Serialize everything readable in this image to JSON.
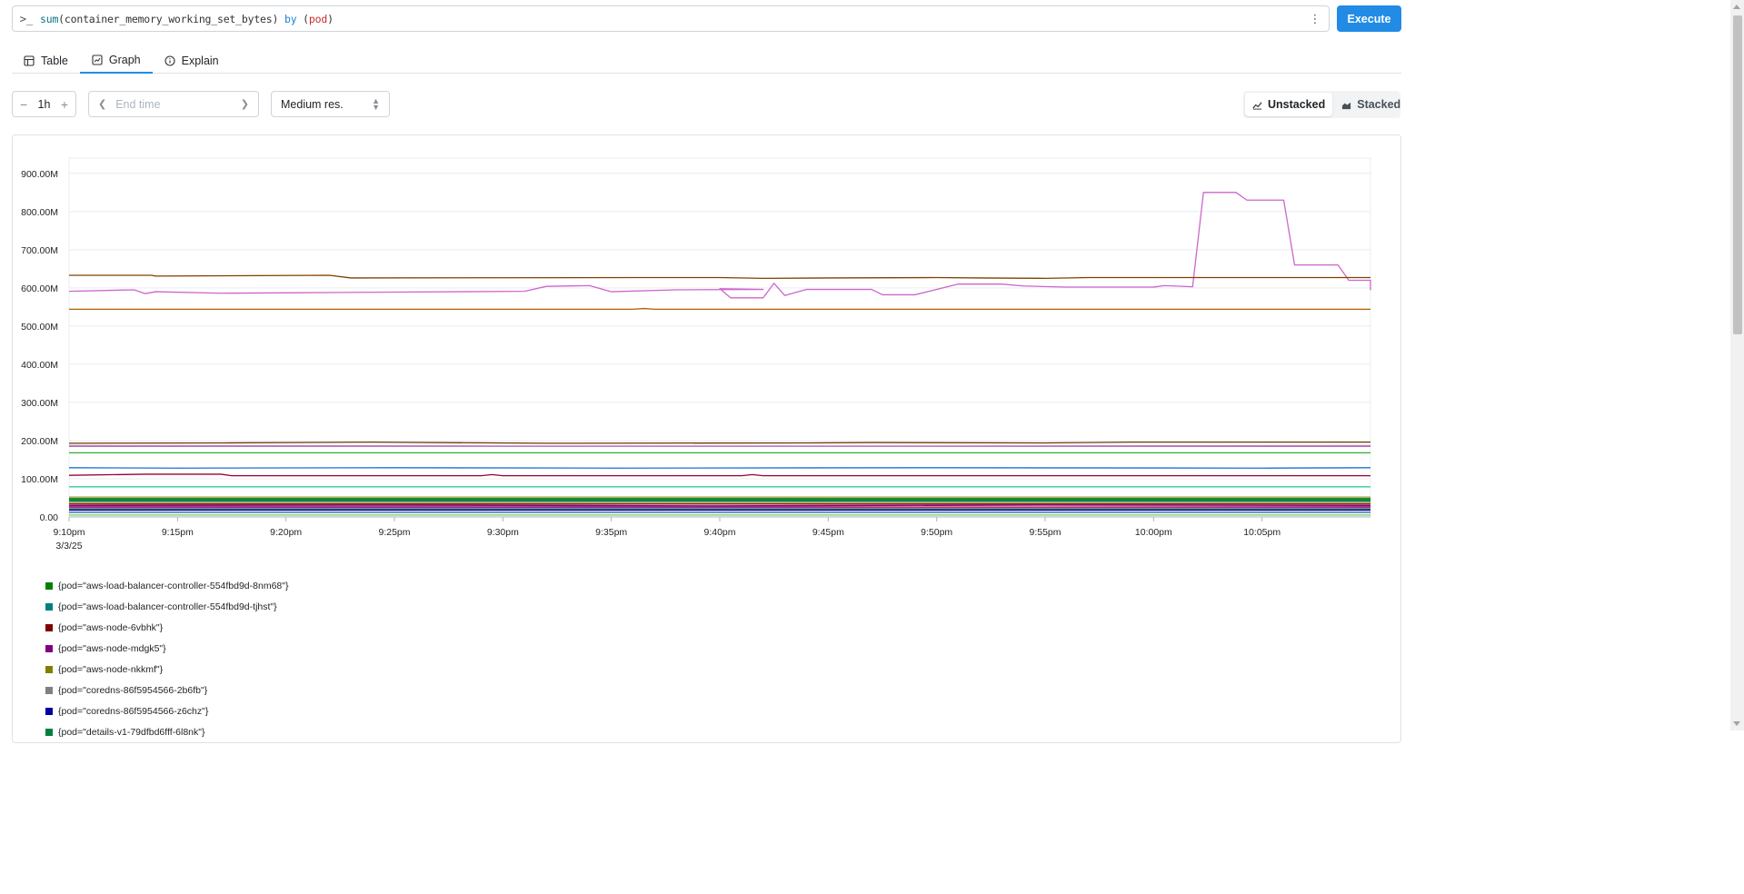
{
  "query": {
    "prompt": ">_",
    "fn": "sum",
    "arg": "(container_memory_working_set_bytes)",
    "by": "by",
    "open_paren": "(",
    "label": "pod",
    "close_paren": ")",
    "menu_icon": "dots-vertical-icon",
    "execute_label": "Execute"
  },
  "tabs": [
    {
      "label": "Table",
      "icon": "table-icon",
      "active": false
    },
    {
      "label": "Graph",
      "icon": "chart-area-icon",
      "active": true
    },
    {
      "label": "Explain",
      "icon": "info-circle-icon",
      "active": false
    }
  ],
  "controls": {
    "range_value": "1h",
    "minus": "−",
    "plus": "+",
    "end_time_placeholder": "End time",
    "resolution": "Medium res.",
    "unstacked_label": "Unstacked",
    "stacked_label": "Stacked",
    "mode": "unstacked"
  },
  "chart_data": {
    "type": "line",
    "y_ticks": [
      "0.00",
      "100.00M",
      "200.00M",
      "300.00M",
      "400.00M",
      "500.00M",
      "600.00M",
      "700.00M",
      "800.00M",
      "900.00M"
    ],
    "ylim": [
      0,
      940
    ],
    "y_unit": "M",
    "x_ticks": [
      "9:10pm",
      "9:15pm",
      "9:20pm",
      "9:25pm",
      "9:30pm",
      "9:35pm",
      "9:40pm",
      "9:45pm",
      "9:50pm",
      "9:55pm",
      "10:00pm",
      "10:05pm"
    ],
    "x_tick_minutes": [
      0,
      5,
      10,
      15,
      20,
      25,
      30,
      35,
      40,
      45,
      50,
      55
    ],
    "x_date_label": "3/3/25",
    "xlim_minutes": [
      0,
      60
    ],
    "grid": true,
    "legend_position": "bottom",
    "series": [
      {
        "name": "{pod=\"aws-load-balancer-controller-554fbd9d-8nm68\"}",
        "color": "#008000",
        "points": [
          [
            0,
            48
          ],
          [
            60,
            48
          ]
        ]
      },
      {
        "name": "{pod=\"aws-load-balancer-controller-554fbd9d-tjhst\"}",
        "color": "#008080",
        "points": [
          [
            0,
            44
          ],
          [
            60,
            44
          ]
        ]
      },
      {
        "name": "{pod=\"aws-node-6vbhk\"}",
        "color": "#800000",
        "points": [
          [
            0,
            34
          ],
          [
            60,
            34
          ]
        ]
      },
      {
        "name": "{pod=\"aws-node-mdgk5\"}",
        "color": "#800080",
        "points": [
          [
            0,
            30
          ],
          [
            15,
            31
          ],
          [
            30,
            29
          ],
          [
            45,
            31
          ],
          [
            60,
            30
          ]
        ]
      },
      {
        "name": "{pod=\"aws-node-nkkmf\"}",
        "color": "#808000",
        "points": [
          [
            0,
            38
          ],
          [
            60,
            38
          ]
        ]
      },
      {
        "name": "{pod=\"coredns-86f5954566-2b6fb\"}",
        "color": "#808080",
        "points": [
          [
            0,
            22
          ],
          [
            60,
            22
          ]
        ]
      },
      {
        "name": "{pod=\"coredns-86f5954566-z6chz\"}",
        "color": "#0000a0",
        "points": [
          [
            0,
            18
          ],
          [
            60,
            18
          ]
        ]
      },
      {
        "name": "{pod=\"details-v1-79dfbd6fff-6l8nk\"}",
        "color": "#008040",
        "points": [
          [
            0,
            42
          ],
          [
            60,
            42
          ]
        ]
      },
      {
        "name": "",
        "color": "#804000",
        "points": [
          [
            0,
            633
          ],
          [
            3.8,
            633
          ],
          [
            4,
            631
          ],
          [
            12,
            633
          ],
          [
            13,
            626
          ],
          [
            26,
            627
          ],
          [
            30,
            627
          ],
          [
            32,
            625
          ],
          [
            35,
            626
          ],
          [
            40,
            627
          ],
          [
            42,
            626
          ],
          [
            45,
            625
          ],
          [
            47,
            627
          ],
          [
            53,
            627
          ],
          [
            60,
            627
          ]
        ]
      },
      {
        "name": "",
        "color": "#cc66cc",
        "points": [
          [
            0,
            591
          ],
          [
            3,
            595
          ],
          [
            3.5,
            585
          ],
          [
            4,
            590
          ],
          [
            7,
            586
          ],
          [
            10,
            587
          ],
          [
            15,
            589
          ],
          [
            21,
            591
          ],
          [
            22,
            604
          ],
          [
            24,
            606
          ],
          [
            25,
            590
          ],
          [
            28,
            595
          ],
          [
            32,
            596
          ],
          [
            30,
            598
          ],
          [
            30.5,
            574
          ],
          [
            32,
            574
          ],
          [
            32.5,
            612
          ],
          [
            33,
            580
          ],
          [
            34,
            596
          ],
          [
            37,
            596
          ],
          [
            37.5,
            582
          ],
          [
            39,
            582
          ],
          [
            41,
            610
          ],
          [
            43,
            610
          ],
          [
            44,
            605
          ],
          [
            46,
            602
          ],
          [
            50,
            602
          ],
          [
            50.5,
            606
          ],
          [
            51.8,
            603
          ],
          [
            52.3,
            850
          ],
          [
            53.8,
            850
          ],
          [
            54.3,
            830
          ],
          [
            56,
            830
          ],
          [
            56.5,
            660
          ],
          [
            58.5,
            660
          ],
          [
            59,
            620
          ],
          [
            60,
            620
          ],
          [
            60.5,
            594
          ]
        ]
      },
      {
        "name": "",
        "color": "#b06000",
        "points": [
          [
            0,
            544
          ],
          [
            26,
            544
          ],
          [
            26.5,
            546
          ],
          [
            27,
            544
          ],
          [
            60,
            544
          ]
        ]
      },
      {
        "name": "",
        "color": "#6b3a00",
        "points": [
          [
            0,
            193
          ],
          [
            7,
            194
          ],
          [
            14,
            196
          ],
          [
            22,
            193
          ],
          [
            34,
            194
          ],
          [
            37,
            195
          ],
          [
            45,
            194
          ],
          [
            49,
            196
          ],
          [
            60,
            196
          ]
        ]
      },
      {
        "name": "",
        "color": "#c080c0",
        "points": [
          [
            0,
            187
          ],
          [
            20,
            186
          ],
          [
            40,
            186
          ],
          [
            60,
            187
          ]
        ]
      },
      {
        "name": "",
        "color": "#9b59b6",
        "points": [
          [
            0,
            185
          ],
          [
            60,
            185
          ]
        ]
      },
      {
        "name": "",
        "color": "#33aa33",
        "points": [
          [
            0,
            168
          ],
          [
            60,
            168
          ]
        ]
      },
      {
        "name": "",
        "color": "#1f6fd0",
        "points": [
          [
            0,
            129
          ],
          [
            5,
            128
          ],
          [
            15,
            129
          ],
          [
            25,
            128
          ],
          [
            40,
            129
          ],
          [
            55,
            128
          ],
          [
            60,
            129
          ]
        ]
      },
      {
        "name": "",
        "color": "#990033",
        "points": [
          [
            0,
            109
          ],
          [
            3.5,
            112
          ],
          [
            7,
            112
          ],
          [
            7.5,
            108
          ],
          [
            19,
            108
          ],
          [
            19.5,
            111
          ],
          [
            20,
            108
          ],
          [
            31,
            108
          ],
          [
            31.5,
            111
          ],
          [
            32,
            108
          ],
          [
            60,
            108
          ]
        ]
      },
      {
        "name": "",
        "color": "#33cc99",
        "points": [
          [
            0,
            79
          ],
          [
            60,
            79
          ]
        ]
      },
      {
        "name": "",
        "color": "#999933",
        "points": [
          [
            0,
            52
          ],
          [
            60,
            52
          ]
        ]
      },
      {
        "name": "",
        "color": "#339933",
        "points": [
          [
            0,
            46
          ],
          [
            60,
            46
          ]
        ]
      },
      {
        "name": "",
        "color": "#cc3366",
        "points": [
          [
            0,
            27
          ],
          [
            20,
            28
          ],
          [
            40,
            26
          ],
          [
            60,
            27
          ]
        ]
      },
      {
        "name": "",
        "color": "#6633cc",
        "points": [
          [
            0,
            25
          ],
          [
            60,
            25
          ]
        ]
      },
      {
        "name": "",
        "color": "#0f7a4a",
        "points": [
          [
            0,
            20
          ],
          [
            60,
            20
          ]
        ]
      },
      {
        "name": "",
        "color": "#336699",
        "points": [
          [
            0,
            12
          ],
          [
            60,
            12
          ]
        ]
      },
      {
        "name": "",
        "color": "#66cc66",
        "points": [
          [
            0,
            5
          ],
          [
            60,
            5
          ]
        ]
      }
    ]
  }
}
